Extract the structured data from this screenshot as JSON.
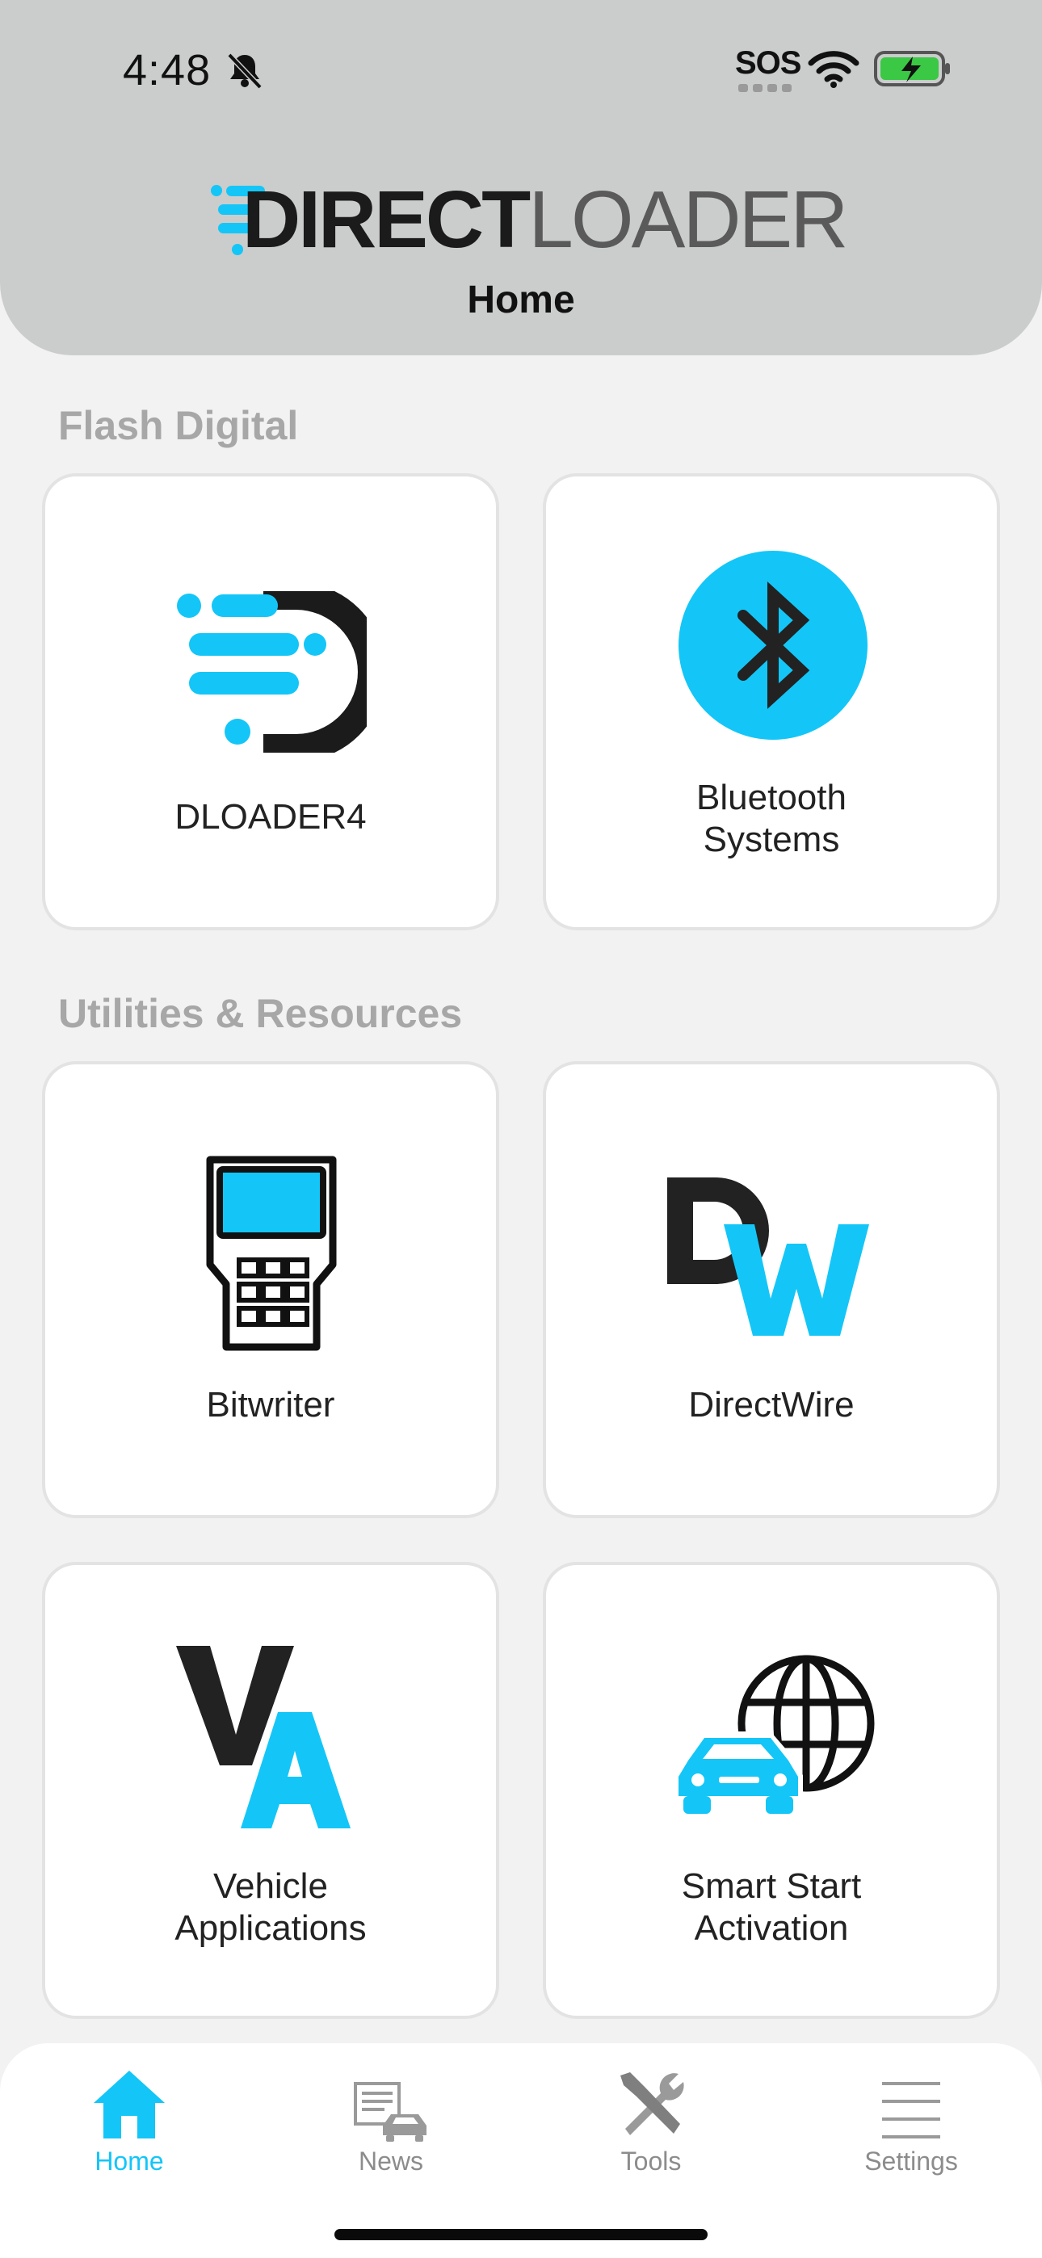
{
  "status_bar": {
    "time": "4:48",
    "sos": "SOS"
  },
  "header": {
    "logo_primary": "DIRECT",
    "logo_secondary": "LOADER",
    "title": "Home"
  },
  "sections": [
    {
      "label": "Flash Digital",
      "cards": [
        {
          "label": "DLOADER4",
          "icon": "dloader-logo-icon"
        },
        {
          "label": "Bluetooth\nSystems",
          "icon": "bluetooth-icon"
        }
      ]
    },
    {
      "label": "Utilities & Resources",
      "cards": [
        {
          "label": "Bitwriter",
          "icon": "bitwriter-device-icon"
        },
        {
          "label": "DirectWire",
          "icon": "directwire-logo-icon"
        },
        {
          "label": "Vehicle\nApplications",
          "icon": "vehicle-applications-logo-icon"
        },
        {
          "label": "Smart Start\nActivation",
          "icon": "car-globe-icon"
        }
      ]
    }
  ],
  "tabs": [
    {
      "label": "Home",
      "icon": "home-icon",
      "active": true
    },
    {
      "label": "News",
      "icon": "news-car-icon",
      "active": false
    },
    {
      "label": "Tools",
      "icon": "tools-icon",
      "active": false
    },
    {
      "label": "Settings",
      "icon": "settings-lines-icon",
      "active": false
    }
  ],
  "colors": {
    "accent": "#13c6f7",
    "header_bg": "#cbcccc",
    "page_bg": "#f2f2f2",
    "section_label": "#a7a7a7"
  }
}
